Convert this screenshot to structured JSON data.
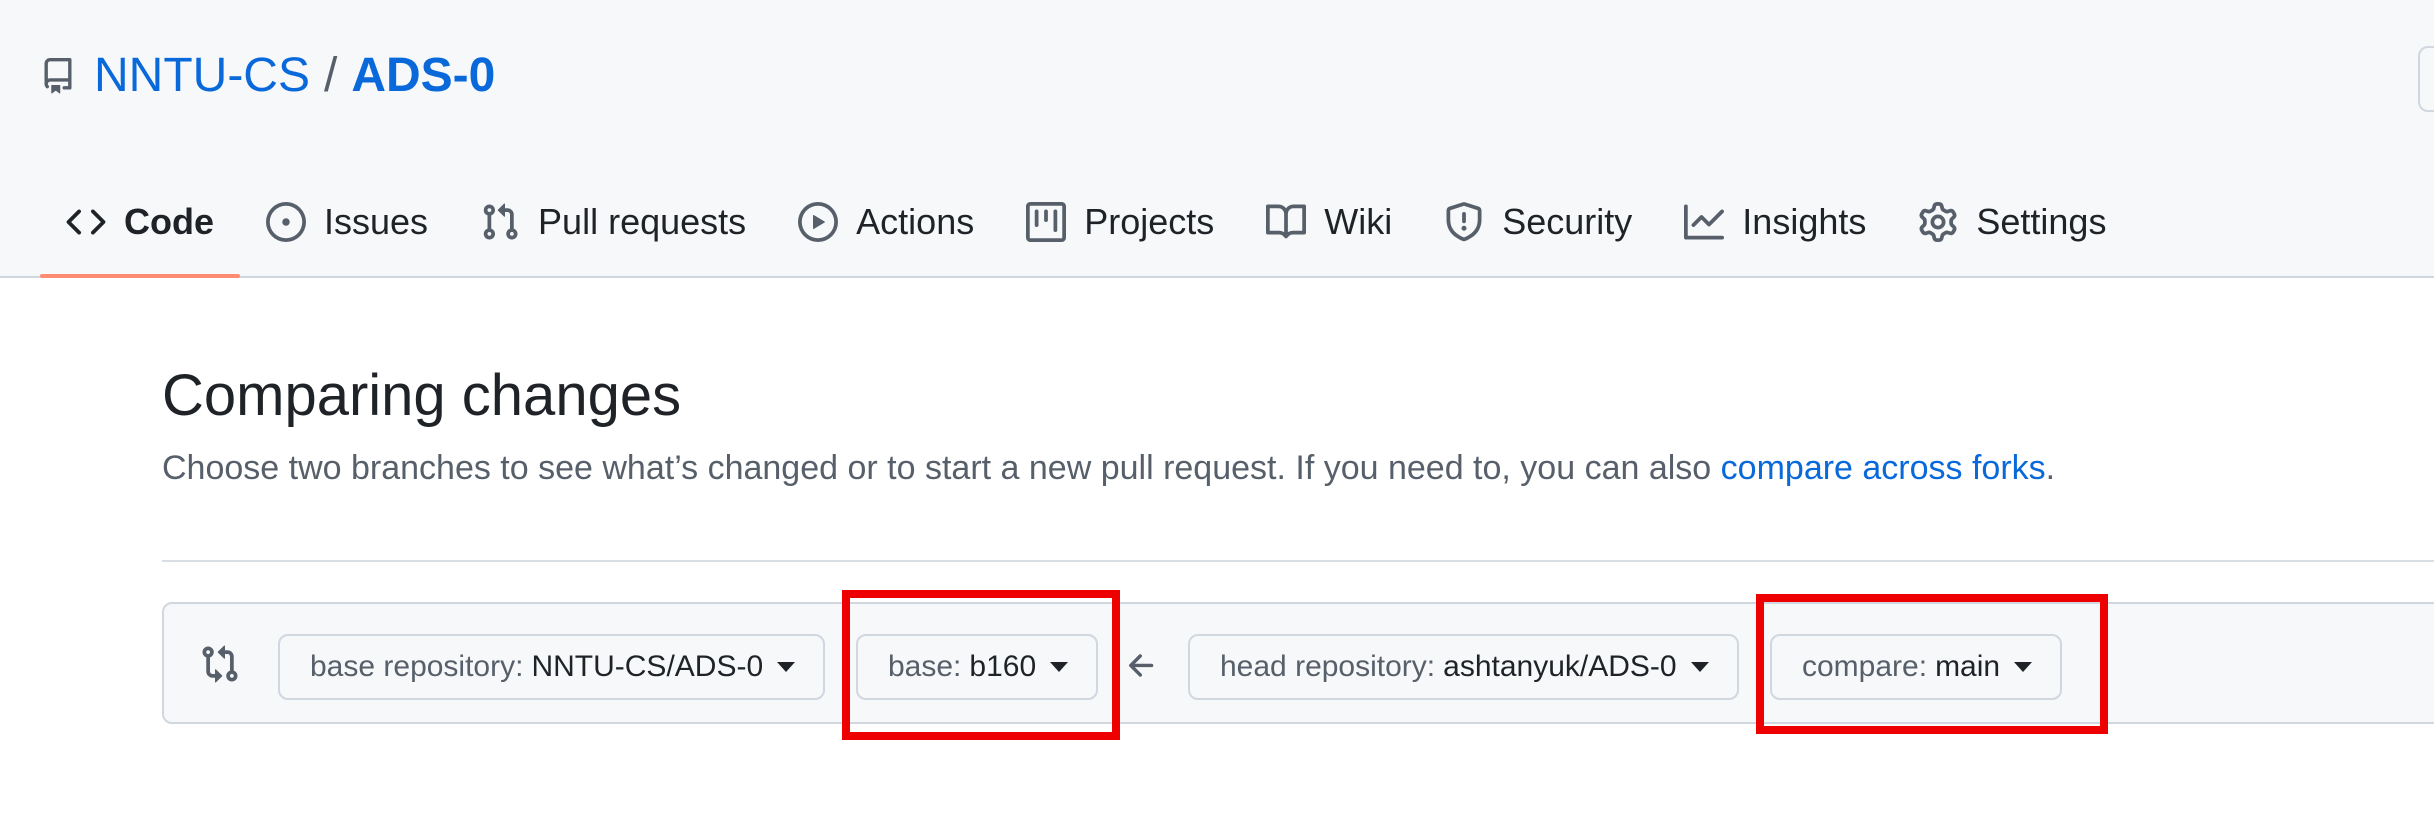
{
  "repo": {
    "owner": "NNTU-CS",
    "separator": "/",
    "name": "ADS-0"
  },
  "tabs": [
    {
      "label": "Code",
      "icon": "code-icon",
      "selected": true
    },
    {
      "label": "Issues",
      "icon": "issue-opened-icon"
    },
    {
      "label": "Pull requests",
      "icon": "git-pull-request-icon"
    },
    {
      "label": "Actions",
      "icon": "play-icon"
    },
    {
      "label": "Projects",
      "icon": "project-icon"
    },
    {
      "label": "Wiki",
      "icon": "book-icon"
    },
    {
      "label": "Security",
      "icon": "shield-icon"
    },
    {
      "label": "Insights",
      "icon": "graph-icon"
    },
    {
      "label": "Settings",
      "icon": "gear-icon"
    }
  ],
  "compare": {
    "title": "Comparing changes",
    "description": "Choose two branches to see what’s changed or to start a new pull request. If you need to, you can also",
    "forks_link": "compare across forks",
    "period": ".",
    "base_repo_label": "base repository:",
    "base_repo_value": "NNTU-CS/ADS-0",
    "base_label": "base:",
    "base_value": "b160",
    "head_repo_label": "head repository:",
    "head_repo_value": "ashtanyuk/ADS-0",
    "compare_label": "compare:",
    "compare_value": "main"
  },
  "colors": {
    "link": "#0969da",
    "tab_underline": "#fd8c73",
    "highlight": "#ee0000",
    "header_bg": "#f6f8fa"
  }
}
